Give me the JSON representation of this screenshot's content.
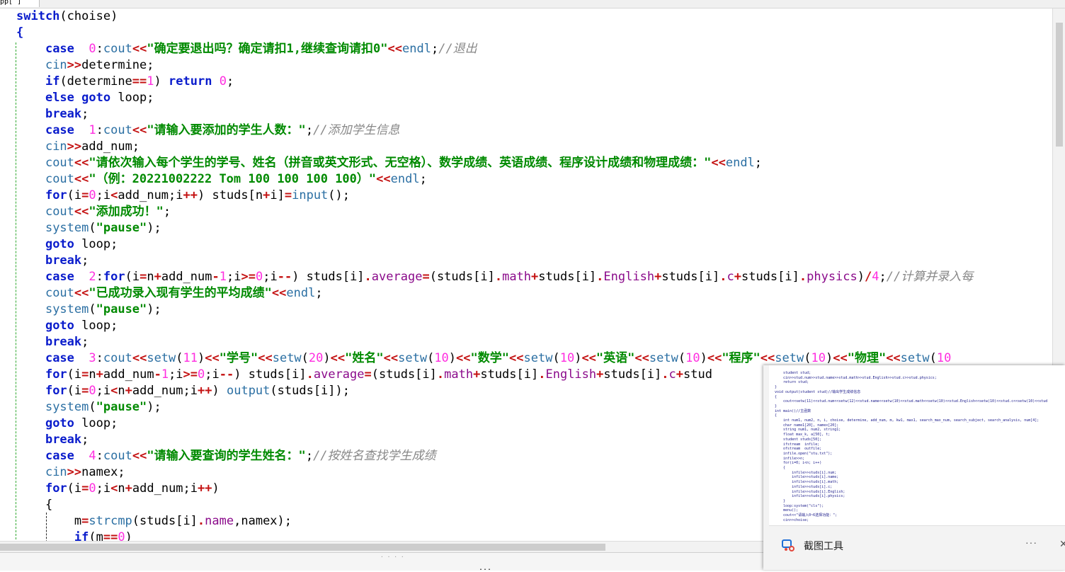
{
  "tab": {
    "label": "pp[ ]"
  },
  "code_lines": [
    [
      {
        "t": "switch",
        "c": "kw"
      },
      {
        "t": "(choise)"
      }
    ],
    [
      {
        "t": "{",
        "c": "kw"
      }
    ],
    [
      {
        "t": "    "
      },
      {
        "t": "case",
        "c": "kw"
      },
      {
        "t": "  "
      },
      {
        "t": "0",
        "c": "num"
      },
      {
        "t": ":"
      },
      {
        "t": "cout",
        "c": "fn"
      },
      {
        "t": "<<",
        "c": "op"
      },
      {
        "t": "\"确定要退出吗？确定请扣1,继续查询请扣0\"",
        "c": "str"
      },
      {
        "t": "<<",
        "c": "op"
      },
      {
        "t": "endl",
        "c": "fn"
      },
      {
        "t": ";"
      },
      {
        "t": "//退出",
        "c": "cm"
      }
    ],
    [
      {
        "t": "    "
      },
      {
        "t": "cin",
        "c": "fn"
      },
      {
        "t": ">>",
        "c": "op"
      },
      {
        "t": "determine;"
      }
    ],
    [
      {
        "t": "    "
      },
      {
        "t": "if",
        "c": "kw"
      },
      {
        "t": "(determine"
      },
      {
        "t": "==",
        "c": "op"
      },
      {
        "t": "1",
        "c": "num"
      },
      {
        "t": ") "
      },
      {
        "t": "return",
        "c": "kw"
      },
      {
        "t": " "
      },
      {
        "t": "0",
        "c": "num"
      },
      {
        "t": ";"
      }
    ],
    [
      {
        "t": "    "
      },
      {
        "t": "else goto",
        "c": "kw"
      },
      {
        "t": " loop;"
      }
    ],
    [
      {
        "t": "    "
      },
      {
        "t": "break",
        "c": "kw"
      },
      {
        "t": ";"
      }
    ],
    [
      {
        "t": "    "
      },
      {
        "t": "case",
        "c": "kw"
      },
      {
        "t": "  "
      },
      {
        "t": "1",
        "c": "num"
      },
      {
        "t": ":"
      },
      {
        "t": "cout",
        "c": "fn"
      },
      {
        "t": "<<",
        "c": "op"
      },
      {
        "t": "\"请输入要添加的学生人数：\"",
        "c": "str"
      },
      {
        "t": ";"
      },
      {
        "t": "//添加学生信息",
        "c": "cm"
      }
    ],
    [
      {
        "t": "    "
      },
      {
        "t": "cin",
        "c": "fn"
      },
      {
        "t": ">>",
        "c": "op"
      },
      {
        "t": "add_num;"
      }
    ],
    [
      {
        "t": "    "
      },
      {
        "t": "cout",
        "c": "fn"
      },
      {
        "t": "<<",
        "c": "op"
      },
      {
        "t": "\"请依次输入每个学生的学号、姓名（拼音或英文形式、无空格）、数学成绩、英语成绩、程序设计成绩和物理成绩：\"",
        "c": "str"
      },
      {
        "t": "<<",
        "c": "op"
      },
      {
        "t": "endl",
        "c": "fn"
      },
      {
        "t": ";"
      }
    ],
    [
      {
        "t": "    "
      },
      {
        "t": "cout",
        "c": "fn"
      },
      {
        "t": "<<",
        "c": "op"
      },
      {
        "t": "\"（例：20221002222 Tom 100 100 100 100）\"",
        "c": "str"
      },
      {
        "t": "<<",
        "c": "op"
      },
      {
        "t": "endl",
        "c": "fn"
      },
      {
        "t": ";"
      }
    ],
    [
      {
        "t": "    "
      },
      {
        "t": "for",
        "c": "kw"
      },
      {
        "t": "(i"
      },
      {
        "t": "=",
        "c": "op"
      },
      {
        "t": "0",
        "c": "num"
      },
      {
        "t": ";i"
      },
      {
        "t": "<",
        "c": "op"
      },
      {
        "t": "add_num;i"
      },
      {
        "t": "++",
        "c": "op"
      },
      {
        "t": ") studs[n"
      },
      {
        "t": "+",
        "c": "op"
      },
      {
        "t": "i]"
      },
      {
        "t": "=",
        "c": "op"
      },
      {
        "t": "input",
        "c": "fn"
      },
      {
        "t": "();"
      }
    ],
    [
      {
        "t": "    "
      },
      {
        "t": "cout",
        "c": "fn"
      },
      {
        "t": "<<",
        "c": "op"
      },
      {
        "t": "\"添加成功！\"",
        "c": "str"
      },
      {
        "t": ";"
      }
    ],
    [
      {
        "t": "    "
      },
      {
        "t": "system",
        "c": "fn"
      },
      {
        "t": "("
      },
      {
        "t": "\"pause\"",
        "c": "str"
      },
      {
        "t": ");"
      }
    ],
    [
      {
        "t": "    "
      },
      {
        "t": "goto",
        "c": "kw"
      },
      {
        "t": " loop;"
      }
    ],
    [
      {
        "t": "    "
      },
      {
        "t": "break",
        "c": "kw"
      },
      {
        "t": ";"
      }
    ],
    [
      {
        "t": "    "
      },
      {
        "t": "case",
        "c": "kw"
      },
      {
        "t": "  "
      },
      {
        "t": "2",
        "c": "num"
      },
      {
        "t": ":"
      },
      {
        "t": "for",
        "c": "kw"
      },
      {
        "t": "(i"
      },
      {
        "t": "=",
        "c": "op"
      },
      {
        "t": "n"
      },
      {
        "t": "+",
        "c": "op"
      },
      {
        "t": "add_num"
      },
      {
        "t": "-",
        "c": "op"
      },
      {
        "t": "1",
        "c": "num"
      },
      {
        "t": ";i"
      },
      {
        "t": ">=",
        "c": "op"
      },
      {
        "t": "0",
        "c": "num"
      },
      {
        "t": ";i"
      },
      {
        "t": "--",
        "c": "op"
      },
      {
        "t": ") studs[i]"
      },
      {
        "t": ".",
        "c": "op"
      },
      {
        "t": "average",
        "c": "mem"
      },
      {
        "t": "=",
        "c": "op"
      },
      {
        "t": "(studs[i]"
      },
      {
        "t": ".",
        "c": "op"
      },
      {
        "t": "math",
        "c": "mem"
      },
      {
        "t": "+",
        "c": "op"
      },
      {
        "t": "studs[i]"
      },
      {
        "t": ".",
        "c": "op"
      },
      {
        "t": "English",
        "c": "mem"
      },
      {
        "t": "+",
        "c": "op"
      },
      {
        "t": "studs[i]"
      },
      {
        "t": ".",
        "c": "op"
      },
      {
        "t": "c",
        "c": "mem"
      },
      {
        "t": "+",
        "c": "op"
      },
      {
        "t": "studs[i]"
      },
      {
        "t": ".",
        "c": "op"
      },
      {
        "t": "physics",
        "c": "mem"
      },
      {
        "t": ")"
      },
      {
        "t": "/",
        "c": "op"
      },
      {
        "t": "4",
        "c": "num"
      },
      {
        "t": ";"
      },
      {
        "t": "//计算并录入每",
        "c": "cm"
      }
    ],
    [
      {
        "t": "    "
      },
      {
        "t": "cout",
        "c": "fn"
      },
      {
        "t": "<<",
        "c": "op"
      },
      {
        "t": "\"已成功录入现有学生的平均成绩\"",
        "c": "str"
      },
      {
        "t": "<<",
        "c": "op"
      },
      {
        "t": "endl",
        "c": "fn"
      },
      {
        "t": ";"
      }
    ],
    [
      {
        "t": "    "
      },
      {
        "t": "system",
        "c": "fn"
      },
      {
        "t": "("
      },
      {
        "t": "\"pause\"",
        "c": "str"
      },
      {
        "t": ");"
      }
    ],
    [
      {
        "t": "    "
      },
      {
        "t": "goto",
        "c": "kw"
      },
      {
        "t": " loop;"
      }
    ],
    [
      {
        "t": "    "
      },
      {
        "t": "break",
        "c": "kw"
      },
      {
        "t": ";"
      }
    ],
    [
      {
        "t": "    "
      },
      {
        "t": "case",
        "c": "kw"
      },
      {
        "t": "  "
      },
      {
        "t": "3",
        "c": "num"
      },
      {
        "t": ":"
      },
      {
        "t": "cout",
        "c": "fn"
      },
      {
        "t": "<<",
        "c": "op"
      },
      {
        "t": "setw",
        "c": "fn"
      },
      {
        "t": "("
      },
      {
        "t": "11",
        "c": "num"
      },
      {
        "t": ")"
      },
      {
        "t": "<<",
        "c": "op"
      },
      {
        "t": "\"学号\"",
        "c": "str"
      },
      {
        "t": "<<",
        "c": "op"
      },
      {
        "t": "setw",
        "c": "fn"
      },
      {
        "t": "("
      },
      {
        "t": "20",
        "c": "num"
      },
      {
        "t": ")"
      },
      {
        "t": "<<",
        "c": "op"
      },
      {
        "t": "\"姓名\"",
        "c": "str"
      },
      {
        "t": "<<",
        "c": "op"
      },
      {
        "t": "setw",
        "c": "fn"
      },
      {
        "t": "("
      },
      {
        "t": "10",
        "c": "num"
      },
      {
        "t": ")"
      },
      {
        "t": "<<",
        "c": "op"
      },
      {
        "t": "\"数学\"",
        "c": "str"
      },
      {
        "t": "<<",
        "c": "op"
      },
      {
        "t": "setw",
        "c": "fn"
      },
      {
        "t": "("
      },
      {
        "t": "10",
        "c": "num"
      },
      {
        "t": ")"
      },
      {
        "t": "<<",
        "c": "op"
      },
      {
        "t": "\"英语\"",
        "c": "str"
      },
      {
        "t": "<<",
        "c": "op"
      },
      {
        "t": "setw",
        "c": "fn"
      },
      {
        "t": "("
      },
      {
        "t": "10",
        "c": "num"
      },
      {
        "t": ")"
      },
      {
        "t": "<<",
        "c": "op"
      },
      {
        "t": "\"程序\"",
        "c": "str"
      },
      {
        "t": "<<",
        "c": "op"
      },
      {
        "t": "setw",
        "c": "fn"
      },
      {
        "t": "("
      },
      {
        "t": "10",
        "c": "num"
      },
      {
        "t": ")"
      },
      {
        "t": "<<",
        "c": "op"
      },
      {
        "t": "\"物理\"",
        "c": "str"
      },
      {
        "t": "<<",
        "c": "op"
      },
      {
        "t": "setw",
        "c": "fn"
      },
      {
        "t": "("
      },
      {
        "t": "10",
        "c": "num"
      }
    ],
    [
      {
        "t": "    "
      },
      {
        "t": "for",
        "c": "kw"
      },
      {
        "t": "(i"
      },
      {
        "t": "=",
        "c": "op"
      },
      {
        "t": "n"
      },
      {
        "t": "+",
        "c": "op"
      },
      {
        "t": "add_num"
      },
      {
        "t": "-",
        "c": "op"
      },
      {
        "t": "1",
        "c": "num"
      },
      {
        "t": ";i"
      },
      {
        "t": ">=",
        "c": "op"
      },
      {
        "t": "0",
        "c": "num"
      },
      {
        "t": ";i"
      },
      {
        "t": "--",
        "c": "op"
      },
      {
        "t": ") studs[i]"
      },
      {
        "t": ".",
        "c": "op"
      },
      {
        "t": "average",
        "c": "mem"
      },
      {
        "t": "=",
        "c": "op"
      },
      {
        "t": "(studs[i]"
      },
      {
        "t": ".",
        "c": "op"
      },
      {
        "t": "math",
        "c": "mem"
      },
      {
        "t": "+",
        "c": "op"
      },
      {
        "t": "studs[i]"
      },
      {
        "t": ".",
        "c": "op"
      },
      {
        "t": "English",
        "c": "mem"
      },
      {
        "t": "+",
        "c": "op"
      },
      {
        "t": "studs[i]"
      },
      {
        "t": ".",
        "c": "op"
      },
      {
        "t": "c",
        "c": "mem"
      },
      {
        "t": "+",
        "c": "op"
      },
      {
        "t": "stud"
      }
    ],
    [
      {
        "t": "    "
      },
      {
        "t": "for",
        "c": "kw"
      },
      {
        "t": "(i"
      },
      {
        "t": "=",
        "c": "op"
      },
      {
        "t": "0",
        "c": "num"
      },
      {
        "t": ";i"
      },
      {
        "t": "<",
        "c": "op"
      },
      {
        "t": "n"
      },
      {
        "t": "+",
        "c": "op"
      },
      {
        "t": "add_num;i"
      },
      {
        "t": "++",
        "c": "op"
      },
      {
        "t": ") "
      },
      {
        "t": "output",
        "c": "fn"
      },
      {
        "t": "(studs[i]);"
      }
    ],
    [
      {
        "t": "    "
      },
      {
        "t": "system",
        "c": "fn"
      },
      {
        "t": "("
      },
      {
        "t": "\"pause\"",
        "c": "str"
      },
      {
        "t": ");"
      }
    ],
    [
      {
        "t": "    "
      },
      {
        "t": "goto",
        "c": "kw"
      },
      {
        "t": " loop;"
      }
    ],
    [
      {
        "t": "    "
      },
      {
        "t": "break",
        "c": "kw"
      },
      {
        "t": ";"
      }
    ],
    [
      {
        "t": "    "
      },
      {
        "t": "case",
        "c": "kw"
      },
      {
        "t": "  "
      },
      {
        "t": "4",
        "c": "num"
      },
      {
        "t": ":"
      },
      {
        "t": "cout",
        "c": "fn"
      },
      {
        "t": "<<",
        "c": "op"
      },
      {
        "t": "\"请输入要查询的学生姓名：\"",
        "c": "str"
      },
      {
        "t": ";"
      },
      {
        "t": "//按姓名查找学生成绩",
        "c": "cm"
      }
    ],
    [
      {
        "t": "    "
      },
      {
        "t": "cin",
        "c": "fn"
      },
      {
        "t": ">>",
        "c": "op"
      },
      {
        "t": "namex;"
      }
    ],
    [
      {
        "t": "    "
      },
      {
        "t": "for",
        "c": "kw"
      },
      {
        "t": "(i"
      },
      {
        "t": "=",
        "c": "op"
      },
      {
        "t": "0",
        "c": "num"
      },
      {
        "t": ";i"
      },
      {
        "t": "<",
        "c": "op"
      },
      {
        "t": "n"
      },
      {
        "t": "+",
        "c": "op"
      },
      {
        "t": "add_num;i"
      },
      {
        "t": "++",
        "c": "op"
      },
      {
        "t": ")"
      }
    ],
    [
      {
        "t": "    "
      },
      {
        "t": "{"
      }
    ],
    [
      {
        "t": "        m"
      },
      {
        "t": "=",
        "c": "op"
      },
      {
        "t": "strcmp",
        "c": "fn"
      },
      {
        "t": "(studs[i]"
      },
      {
        "t": ".",
        "c": "op"
      },
      {
        "t": "name",
        "c": "mem"
      },
      {
        "t": ",namex);"
      }
    ],
    [
      {
        "t": "        "
      },
      {
        "t": "if",
        "c": "kw"
      },
      {
        "t": "(m"
      },
      {
        "t": "==",
        "c": "op"
      },
      {
        "t": "0",
        "c": "num"
      },
      {
        "t": ")"
      }
    ]
  ],
  "snip_popup": {
    "title": "截图工具",
    "more_label": "···",
    "close_label": "✕",
    "thumbnail_code": [
      "    student stud;",
      "    cin>>stud.num>>stud.name>>stud.math>>stud.English>>stud.c>>stud.physics;",
      "    return stud;",
      "}",
      "void output(student stud)//输出学生成绩信息",
      "{",
      "    cout<<setw(11)<<stud.num<<setw(12)<<stud.name<<setw(10)<<stud.math<<setw(10)<<stud.English<<setw(10)<<stud.c<<setw(10)<<stud",
      "}",
      "int main()//主函数",
      "{",
      "    int num1, num2, n, i, choise, determine, add_num, m, kw1, max1, search_max_num, search_subject, search_analysis, num[4];",
      "    char name1[20], namex[20];",
      "    string num1, num2, string1;",
      "    float max_k, a[50], t;",
      "    student studs[50];",
      "    ifstream  infile;",
      "    ofstream  outfile;",
      "    infile.open(\"stu.txt\");",
      "    infile>>n;",
      "    for(i=0; i<n; i++)",
      "    {",
      "        infile>>studs[i].num;",
      "        infile>>studs[i].name;",
      "        infile>>studs[i].math;",
      "        infile>>studs[i].c;",
      "        infile>>studs[i].English;",
      "        infile>>studs[i].physics;",
      "    }",
      "    loop:system(\"cls\");",
      "    menu();",
      "    cout<<\"请输入0~6选择功能：\";",
      "    cin>>choise;"
    ]
  },
  "bottom_panel": {
    "label": "..."
  },
  "colors": {
    "keyword": "#0a1ccc",
    "function": "#2b6fa3",
    "number": "#ff2ee0",
    "string": "#008a00",
    "comment": "#888888",
    "operator": "#c41212",
    "member": "#8b0b8b"
  }
}
